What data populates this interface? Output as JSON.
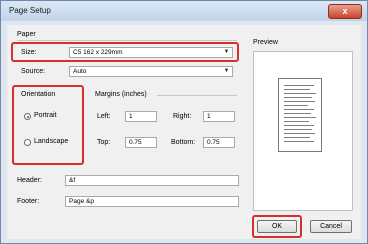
{
  "window": {
    "title": "Page Setup",
    "close_glyph": "x"
  },
  "paper": {
    "group_label": "Paper",
    "size_label": "Size:",
    "size_value": "C5 162 x 229mm",
    "source_label": "Source:",
    "source_value": "Auto"
  },
  "orientation": {
    "group_label": "Orientation",
    "portrait_label": "Portrait",
    "landscape_label": "Landscape",
    "selected": "Portrait"
  },
  "margins": {
    "group_label": "Margins (inches)",
    "left_label": "Left:",
    "left_value": "1",
    "right_label": "Right:",
    "right_value": "1",
    "top_label": "Top:",
    "top_value": "0.75",
    "bottom_label": "Bottom:",
    "bottom_value": "0.75"
  },
  "header": {
    "label": "Header:",
    "value": "&f"
  },
  "footer": {
    "label": "Footer:",
    "value": "Page &p"
  },
  "preview": {
    "label": "Preview"
  },
  "buttons": {
    "ok": "OK",
    "cancel": "Cancel"
  },
  "colors": {
    "highlight": "#d5302e",
    "titlebar": "#c2d4ea",
    "close": "#c9432b"
  },
  "icons": {
    "dropdown": "chevron-down-icon",
    "close": "close-icon"
  }
}
